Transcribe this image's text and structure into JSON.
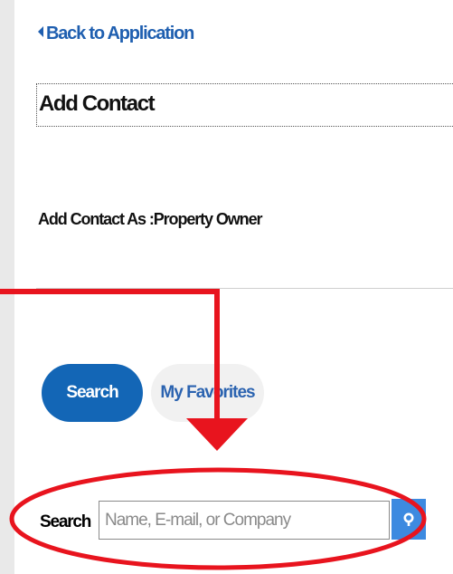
{
  "nav": {
    "back_label": "Back to Application"
  },
  "header": {
    "title": "Add Contact"
  },
  "contact_type": {
    "label": "Add Contact As",
    "separator": ":",
    "value": "Property Owner"
  },
  "tabs": [
    {
      "label": "Search",
      "active": true
    },
    {
      "label": "My Favorites",
      "active": false
    }
  ],
  "search": {
    "label": "Search",
    "value": "",
    "placeholder": "Name, E-mail, or Company"
  },
  "colors": {
    "accent": "#1366b6",
    "link": "#1f5fb0",
    "annotation": "#e8141e",
    "search_button": "#3d8ae0"
  },
  "icons": {
    "back": "caret-left-icon",
    "search_button": "magnifier-icon"
  }
}
